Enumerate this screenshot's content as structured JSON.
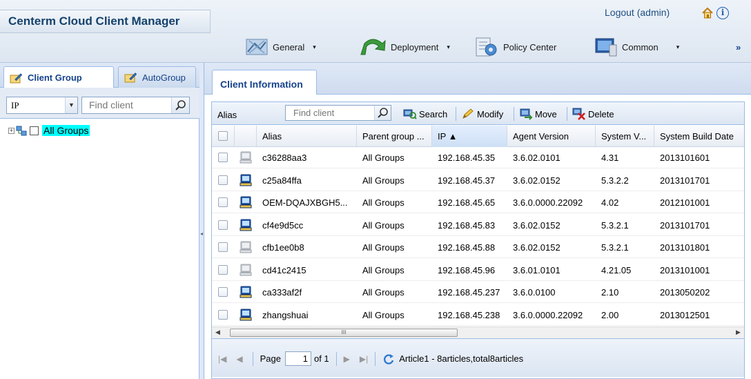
{
  "app": {
    "title": "Centerm Cloud Client Manager",
    "logout": "Logout (admin)"
  },
  "menu": [
    {
      "label": "General",
      "caret": "▾"
    },
    {
      "label": "Deployment",
      "caret": "▾"
    },
    {
      "label": "Policy Center",
      "caret": ""
    },
    {
      "label": "Common",
      "caret": "▾"
    }
  ],
  "menu_more": "»",
  "sidebar": {
    "tabs": [
      "Client Group",
      "AutoGroup"
    ],
    "filter_select": "IP",
    "search_placeholder": "Find client",
    "tree_expander": "+",
    "tree_root": "All Groups"
  },
  "main": {
    "tab": "Client Information",
    "toolbar": {
      "alias_label": "Alias",
      "search_placeholder": "Find client",
      "search": "Search",
      "modify": "Modify",
      "move": "Move",
      "delete": "Delete"
    },
    "columns": [
      "Alias",
      "Parent group ...",
      "IP ▲",
      "Agent Version",
      "System V...",
      "System Build Date"
    ],
    "rows": [
      {
        "online": false,
        "alias": "c36288aa3",
        "group": "All Groups",
        "ip": "192.168.45.35",
        "agent": "3.6.02.0101",
        "sysver": "4.31",
        "build": "2013101601"
      },
      {
        "online": true,
        "alias": "c25a84ffa",
        "group": "All Groups",
        "ip": "192.168.45.37",
        "agent": "3.6.02.0152",
        "sysver": "5.3.2.2",
        "build": "2013101701"
      },
      {
        "online": true,
        "alias": "OEM-DQAJXBGH5...",
        "group": "All Groups",
        "ip": "192.168.45.65",
        "agent": "3.6.0.0000.22092",
        "sysver": "4.02",
        "build": "2012101001"
      },
      {
        "online": true,
        "alias": "cf4e9d5cc",
        "group": "All Groups",
        "ip": "192.168.45.83",
        "agent": "3.6.02.0152",
        "sysver": "5.3.2.1",
        "build": "2013101701"
      },
      {
        "online": false,
        "alias": "cfb1ee0b8",
        "group": "All Groups",
        "ip": "192.168.45.88",
        "agent": "3.6.02.0152",
        "sysver": "5.3.2.1",
        "build": "2013101801"
      },
      {
        "online": false,
        "alias": "cd41c2415",
        "group": "All Groups",
        "ip": "192.168.45.96",
        "agent": "3.6.01.0101",
        "sysver": "4.21.05",
        "build": "2013101001"
      },
      {
        "online": true,
        "alias": "ca333af2f",
        "group": "All Groups",
        "ip": "192.168.45.237",
        "agent": "3.6.0.0100",
        "sysver": "2.10",
        "build": "2013050202"
      },
      {
        "online": true,
        "alias": "zhangshuai",
        "group": "All Groups",
        "ip": "192.168.45.238",
        "agent": "3.6.0.0000.22092",
        "sysver": "2.00",
        "build": "2013012501"
      }
    ],
    "scroll_grip": "III",
    "pager": {
      "page_label": "Page",
      "page": "1",
      "of": "of 1",
      "summary": "Article1 - 8articles,total8articles"
    }
  },
  "colors": {
    "header_title": "#15426c",
    "tab_text": "#15428b",
    "border": "#99bbe8",
    "tree_highlight": "#00ffff"
  }
}
